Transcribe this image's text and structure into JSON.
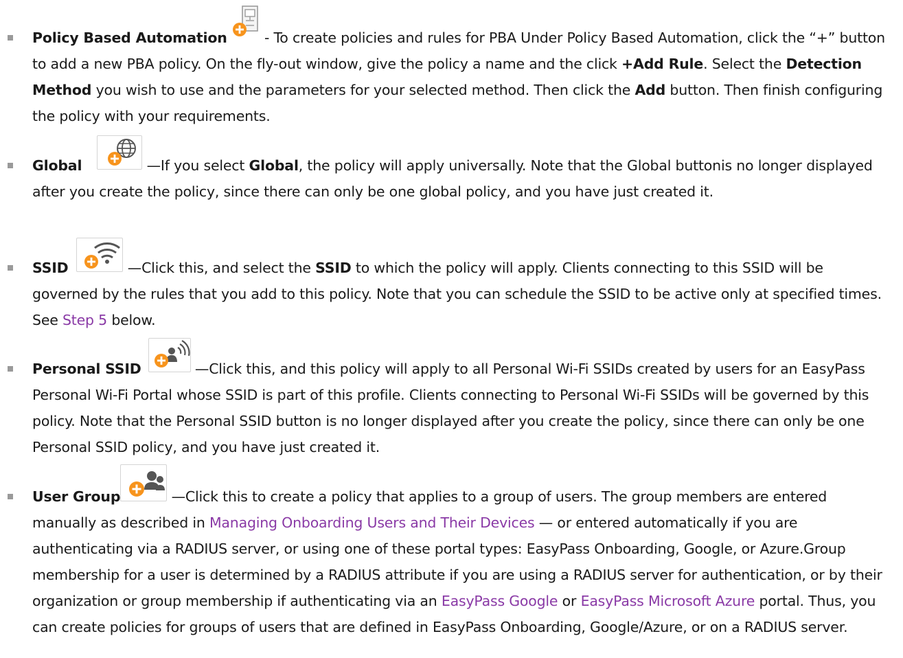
{
  "items": [
    {
      "title": "Policy Based Automation",
      "t1": " - To create policies and rules for PBA Under Policy Based Automation, click the “+” button to add a new PBA policy. On the fly-out window, give the policy a name and the click ",
      "add_rule": "+Add Rule",
      "t2": ". Select the ",
      "detection": "Detection Method",
      "t3": " you wish to use and the parameters for your selected method. Then click the ",
      "add": "Add",
      "t4": " button. Then finish configuring the policy with your requirements."
    },
    {
      "title": "Global",
      "t1": " —If you select ",
      "bold1": "Global",
      "t2": ", the policy will apply universally. Note that the Global buttonis no longer displayed after you create the policy, since there can only be one global policy, and you have just created it."
    },
    {
      "title": "SSID",
      "t1": " —Click this, and select the ",
      "bold1": "SSID",
      "t2": " to which the policy will apply. Clients connecting to this SSID will be governed by the rules that you add to this policy. Note that you can schedule the SSID to be active only at specified times. See ",
      "link1": "Step 5",
      "t3": " below."
    },
    {
      "title": "Personal SSID",
      "t1": " —Click this, and this policy will apply to all Personal Wi-Fi SSIDs created by users for an EasyPass Personal Wi-Fi Portal whose SSID is part of this profile. Clients connecting to Personal Wi-Fi SSIDs will be governed by this policy. Note that the Personal SSID button is no longer displayed after you create the policy, since there can only be one Personal SSID policy, and you have just created it."
    },
    {
      "title": "User Group",
      "t1": " —Click this to create a policy that applies to a group of users. The group members are entered manually as described in ",
      "link1": "Managing Onboarding Users and Their Devices",
      "t2": " — or entered automatically if you are authenticating via a RADIUS server, or using one of these portal types: EasyPass Onboarding, Google, or Azure.Group membership for a user is determined by a RADIUS attribute if you are using a RADIUS server for authentication, or by their organization or group membership if authenticating via an ",
      "link2": "EasyPass Google",
      "t3": " or ",
      "link3": "EasyPass Microsoft Azure",
      "t4": " portal. Thus, you can create policies for groups of users that are defined in EasyPass Onboarding, Google/Azure, or on a RADIUS server."
    }
  ],
  "icons": [
    "add-pba-policy-icon",
    "add-global-policy-icon",
    "add-ssid-policy-icon",
    "add-personal-ssid-policy-icon",
    "add-user-group-policy-icon"
  ],
  "colors": {
    "link": "#8a3aa6",
    "accent": "#f7941d",
    "bullet": "#9a9a9a"
  }
}
